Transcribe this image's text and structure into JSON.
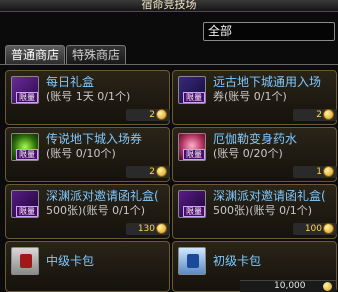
{
  "window": {
    "title": "宿命竞技场"
  },
  "filter": {
    "selected": "全部"
  },
  "tabs": [
    {
      "label": "普通商店",
      "active": true
    },
    {
      "label": "特殊商店",
      "active": false
    }
  ],
  "items": [
    {
      "name": "每日礼盒",
      "limit": "(账号 1天 0/1个)",
      "price": "2",
      "icon": "gift-box-icon",
      "badge": "限量"
    },
    {
      "name": "远古地下城通用入场",
      "limit": "券(账号 0/1个)",
      "price": "2",
      "icon": "ticket-icon",
      "badge": "限量"
    },
    {
      "name": "传说地下城入场券",
      "limit": "(账号 0/10个)",
      "price": "2",
      "icon": "green-ticket-icon",
      "badge": "限量"
    },
    {
      "name": "厄伽勒变身药水",
      "limit": "(账号 0/20个)",
      "price": "1",
      "icon": "potion-icon",
      "badge": "限量"
    },
    {
      "name": "深渊派对邀请函礼盒(",
      "limit": "500张)(账号 0/1个)",
      "price": "130",
      "icon": "abyss-gift-icon",
      "badge": "限量"
    },
    {
      "name": "深渊派对邀请函礼盒(",
      "limit": "500张)(账号 0/1个)",
      "price": "100",
      "icon": "abyss-gift-icon",
      "badge": "限量"
    },
    {
      "name": "中级卡包",
      "limit": "",
      "price": "",
      "icon": "card-pack-icon",
      "badge": ""
    },
    {
      "name": "初级卡包",
      "limit": "",
      "price": "",
      "icon": "card-pack-icon",
      "badge": ""
    }
  ],
  "footer": {
    "currency": "10,000"
  }
}
